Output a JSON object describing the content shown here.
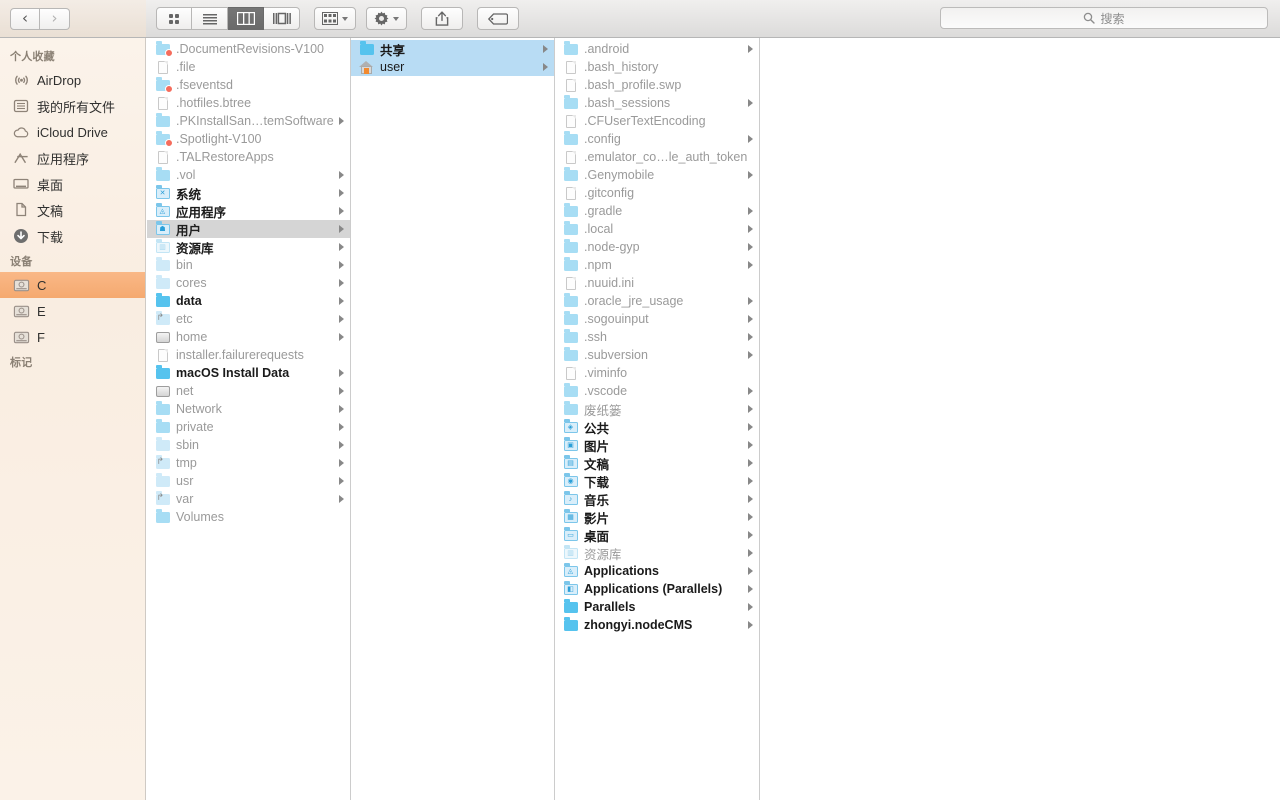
{
  "toolbar": {
    "back_icon": "chevron-left-icon",
    "forward_icon": "chevron-right-icon",
    "view_icon": "grid-view-icon",
    "view_list_icon": "list-view-icon",
    "view_column_icon": "column-view-icon",
    "view_coverflow_icon": "coverflow-view-icon",
    "arrange_icon": "arrange-icon",
    "action_icon": "gear-icon",
    "share_icon": "share-icon",
    "tags_icon": "tag-icon",
    "active_view": "column"
  },
  "search": {
    "placeholder": "搜索",
    "value": "",
    "icon": "search-icon"
  },
  "sidebar": {
    "sections": [
      {
        "header": "个人收藏",
        "items": [
          {
            "label": "AirDrop",
            "icon": "airdrop-icon",
            "selected": false
          },
          {
            "label": "我的所有文件",
            "icon": "all-my-files-icon",
            "selected": false
          },
          {
            "label": "iCloud Drive",
            "icon": "icloud-icon",
            "selected": false
          },
          {
            "label": "应用程序",
            "icon": "applications-icon",
            "selected": false
          },
          {
            "label": "桌面",
            "icon": "desktop-icon",
            "selected": false
          },
          {
            "label": "文稿",
            "icon": "documents-icon",
            "selected": false
          },
          {
            "label": "下载",
            "icon": "downloads-icon",
            "selected": false
          }
        ]
      },
      {
        "header": "设备",
        "items": [
          {
            "label": "C",
            "icon": "harddisk-icon",
            "selected": true
          },
          {
            "label": "E",
            "icon": "harddisk-icon",
            "selected": false
          },
          {
            "label": "F",
            "icon": "harddisk-icon",
            "selected": false
          }
        ]
      },
      {
        "header": "标记",
        "items": []
      }
    ]
  },
  "columns": [
    {
      "name": "column-root",
      "rows": [
        {
          "label": ".DocumentRevisions-V100",
          "icon": "folder-badge-icon",
          "dim": true,
          "arrow": false,
          "sel": "none"
        },
        {
          "label": ".file",
          "icon": "document-icon",
          "dim": true,
          "arrow": false,
          "sel": "none"
        },
        {
          "label": ".fseventsd",
          "icon": "folder-badge-icon",
          "dim": true,
          "arrow": false,
          "sel": "none"
        },
        {
          "label": ".hotfiles.btree",
          "icon": "document-icon",
          "dim": true,
          "arrow": false,
          "sel": "none"
        },
        {
          "label": ".PKInstallSan…temSoftware",
          "icon": "folder-icon",
          "dim": true,
          "arrow": true,
          "sel": "none"
        },
        {
          "label": ".Spotlight-V100",
          "icon": "folder-badge-icon",
          "dim": true,
          "arrow": false,
          "sel": "none"
        },
        {
          "label": ".TALRestoreApps",
          "icon": "document-icon",
          "dim": true,
          "arrow": false,
          "sel": "none"
        },
        {
          "label": ".vol",
          "icon": "folder-icon",
          "dim": true,
          "arrow": true,
          "sel": "none"
        },
        {
          "label": "系统",
          "icon": "system-folder-icon",
          "dim": false,
          "arrow": true,
          "sel": "none",
          "strong": true
        },
        {
          "label": "应用程序",
          "icon": "apps-folder-icon",
          "dim": false,
          "arrow": true,
          "sel": "none",
          "strong": true
        },
        {
          "label": "用户",
          "icon": "users-folder-icon",
          "dim": false,
          "arrow": true,
          "sel": "grey",
          "strong": true
        },
        {
          "label": "资源库",
          "icon": "library-folder-icon",
          "dim": false,
          "arrow": true,
          "sel": "none",
          "strong": true
        },
        {
          "label": "bin",
          "icon": "folder-pale-icon",
          "dim": true,
          "arrow": true,
          "sel": "none"
        },
        {
          "label": "cores",
          "icon": "folder-pale-icon",
          "dim": true,
          "arrow": true,
          "sel": "none"
        },
        {
          "label": "data",
          "icon": "folder-deep-icon",
          "dim": false,
          "arrow": true,
          "sel": "none",
          "strong": true
        },
        {
          "label": "etc",
          "icon": "alias-icon",
          "dim": true,
          "arrow": true,
          "sel": "none"
        },
        {
          "label": "home",
          "icon": "disk-icon",
          "dim": true,
          "arrow": true,
          "sel": "none"
        },
        {
          "label": "installer.failurerequests",
          "icon": "document-icon",
          "dim": true,
          "arrow": false,
          "sel": "none"
        },
        {
          "label": "macOS Install Data",
          "icon": "folder-deep-icon",
          "dim": false,
          "arrow": true,
          "sel": "none",
          "strong": true
        },
        {
          "label": "net",
          "icon": "disk-icon",
          "dim": true,
          "arrow": true,
          "sel": "none"
        },
        {
          "label": "Network",
          "icon": "folder-icon",
          "dim": true,
          "arrow": true,
          "sel": "none"
        },
        {
          "label": "private",
          "icon": "folder-icon",
          "dim": true,
          "arrow": true,
          "sel": "none"
        },
        {
          "label": "sbin",
          "icon": "folder-pale-icon",
          "dim": true,
          "arrow": true,
          "sel": "none"
        },
        {
          "label": "tmp",
          "icon": "alias-icon",
          "dim": true,
          "arrow": true,
          "sel": "none"
        },
        {
          "label": "usr",
          "icon": "folder-pale-icon",
          "dim": true,
          "arrow": true,
          "sel": "none"
        },
        {
          "label": "var",
          "icon": "alias-icon",
          "dim": true,
          "arrow": true,
          "sel": "none"
        },
        {
          "label": "Volumes",
          "icon": "folder-icon",
          "dim": true,
          "arrow": false,
          "sel": "none"
        }
      ]
    },
    {
      "name": "column-users",
      "rows": [
        {
          "label": "共享",
          "icon": "folder-deep-icon",
          "dim": false,
          "arrow": true,
          "sel": "blue",
          "strong": true
        },
        {
          "label": "user",
          "icon": "home-icon",
          "dim": false,
          "arrow": true,
          "sel": "blue"
        }
      ]
    },
    {
      "name": "column-user-home",
      "rows": [
        {
          "label": ".android",
          "icon": "folder-icon",
          "dim": true,
          "arrow": true,
          "sel": "none"
        },
        {
          "label": ".bash_history",
          "icon": "document-icon",
          "dim": true,
          "arrow": false,
          "sel": "none"
        },
        {
          "label": ".bash_profile.swp",
          "icon": "document-icon",
          "dim": true,
          "arrow": false,
          "sel": "none"
        },
        {
          "label": ".bash_sessions",
          "icon": "folder-icon",
          "dim": true,
          "arrow": true,
          "sel": "none"
        },
        {
          "label": ".CFUserTextEncoding",
          "icon": "document-icon",
          "dim": true,
          "arrow": false,
          "sel": "none"
        },
        {
          "label": ".config",
          "icon": "folder-icon",
          "dim": true,
          "arrow": true,
          "sel": "none"
        },
        {
          "label": ".emulator_co…le_auth_token",
          "icon": "document-icon",
          "dim": true,
          "arrow": false,
          "sel": "none"
        },
        {
          "label": ".Genymobile",
          "icon": "folder-icon",
          "dim": true,
          "arrow": true,
          "sel": "none"
        },
        {
          "label": ".gitconfig",
          "icon": "document-icon",
          "dim": true,
          "arrow": false,
          "sel": "none"
        },
        {
          "label": ".gradle",
          "icon": "folder-icon",
          "dim": true,
          "arrow": true,
          "sel": "none"
        },
        {
          "label": ".local",
          "icon": "folder-icon",
          "dim": true,
          "arrow": true,
          "sel": "none"
        },
        {
          "label": ".node-gyp",
          "icon": "folder-icon",
          "dim": true,
          "arrow": true,
          "sel": "none"
        },
        {
          "label": ".npm",
          "icon": "folder-icon",
          "dim": true,
          "arrow": true,
          "sel": "none"
        },
        {
          "label": ".nuuid.ini",
          "icon": "document-icon",
          "dim": true,
          "arrow": false,
          "sel": "none"
        },
        {
          "label": ".oracle_jre_usage",
          "icon": "folder-icon",
          "dim": true,
          "arrow": true,
          "sel": "none"
        },
        {
          "label": ".sogouinput",
          "icon": "folder-icon",
          "dim": true,
          "arrow": true,
          "sel": "none"
        },
        {
          "label": ".ssh",
          "icon": "folder-icon",
          "dim": true,
          "arrow": true,
          "sel": "none"
        },
        {
          "label": ".subversion",
          "icon": "folder-icon",
          "dim": true,
          "arrow": true,
          "sel": "none"
        },
        {
          "label": ".viminfo",
          "icon": "document-icon",
          "dim": true,
          "arrow": false,
          "sel": "none"
        },
        {
          "label": ".vscode",
          "icon": "folder-icon",
          "dim": true,
          "arrow": true,
          "sel": "none"
        },
        {
          "label": "废纸篓",
          "icon": "folder-icon",
          "dim": true,
          "arrow": true,
          "sel": "none"
        },
        {
          "label": "公共",
          "icon": "public-folder-icon",
          "dim": false,
          "arrow": true,
          "sel": "none",
          "strong": true
        },
        {
          "label": "图片",
          "icon": "pictures-folder-icon",
          "dim": false,
          "arrow": true,
          "sel": "none",
          "strong": true
        },
        {
          "label": "文稿",
          "icon": "documents-folder-icon",
          "dim": false,
          "arrow": true,
          "sel": "none",
          "strong": true
        },
        {
          "label": "下载",
          "icon": "downloads-folder-icon",
          "dim": false,
          "arrow": true,
          "sel": "none",
          "strong": true
        },
        {
          "label": "音乐",
          "icon": "music-folder-icon",
          "dim": false,
          "arrow": true,
          "sel": "none",
          "strong": true
        },
        {
          "label": "影片",
          "icon": "movies-folder-icon",
          "dim": false,
          "arrow": true,
          "sel": "none",
          "strong": true
        },
        {
          "label": "桌面",
          "icon": "desktop-folder-icon",
          "dim": false,
          "arrow": true,
          "sel": "none",
          "strong": true
        },
        {
          "label": "资源库",
          "icon": "library-folder-icon",
          "dim": true,
          "arrow": true,
          "sel": "none"
        },
        {
          "label": "Applications",
          "icon": "apps-folder-icon",
          "dim": false,
          "arrow": true,
          "sel": "none",
          "strong": true
        },
        {
          "label": "Applications (Parallels)",
          "icon": "parallels-folder-icon",
          "dim": false,
          "arrow": true,
          "sel": "none",
          "strong": true
        },
        {
          "label": "Parallels",
          "icon": "folder-deep-icon",
          "dim": false,
          "arrow": true,
          "sel": "none",
          "strong": true
        },
        {
          "label": "zhongyi.nodeCMS",
          "icon": "folder-deep-icon",
          "dim": false,
          "arrow": true,
          "sel": "none",
          "strong": true
        }
      ]
    }
  ]
}
